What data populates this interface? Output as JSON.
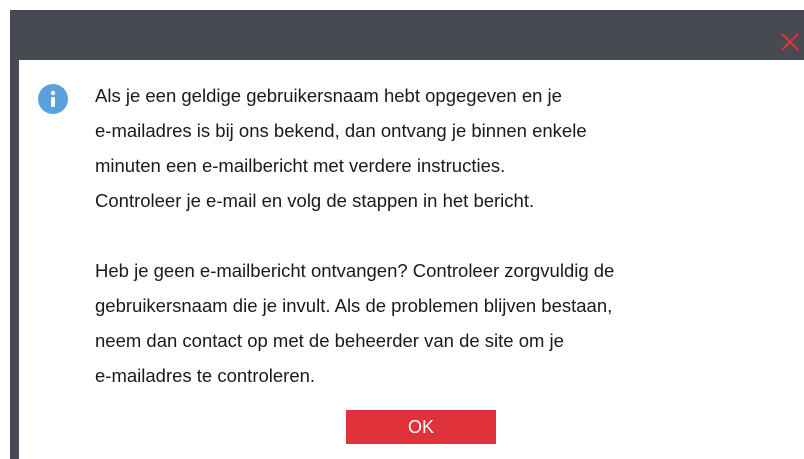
{
  "dialog": {
    "close_icon": "close-icon",
    "info_icon": "info-icon",
    "paragraphs": [
      {
        "lines": [
          "Als je een geldige gebruikersnaam hebt opgegeven en je",
          "e-mailadres is bij ons bekend, dan ontvang je binnen enkele",
          "minuten een e-mailbericht met verdere instructies.",
          "Controleer je e-mail en volg de stappen in het bericht."
        ]
      },
      {
        "lines": [
          "Heb je geen e-mailbericht ontvangen? Controleer zorgvuldig de",
          "gebruikersnaam die je invult. Als de problemen blijven bestaan,",
          "neem dan contact op met de beheerder van de site om je",
          "e-mailadres te controleren."
        ]
      }
    ],
    "ok_label": "OK"
  },
  "colors": {
    "titlebar": "#484a52",
    "close": "#e0323a",
    "info": "#5aa0dc",
    "ok_button": "#e0323a"
  }
}
